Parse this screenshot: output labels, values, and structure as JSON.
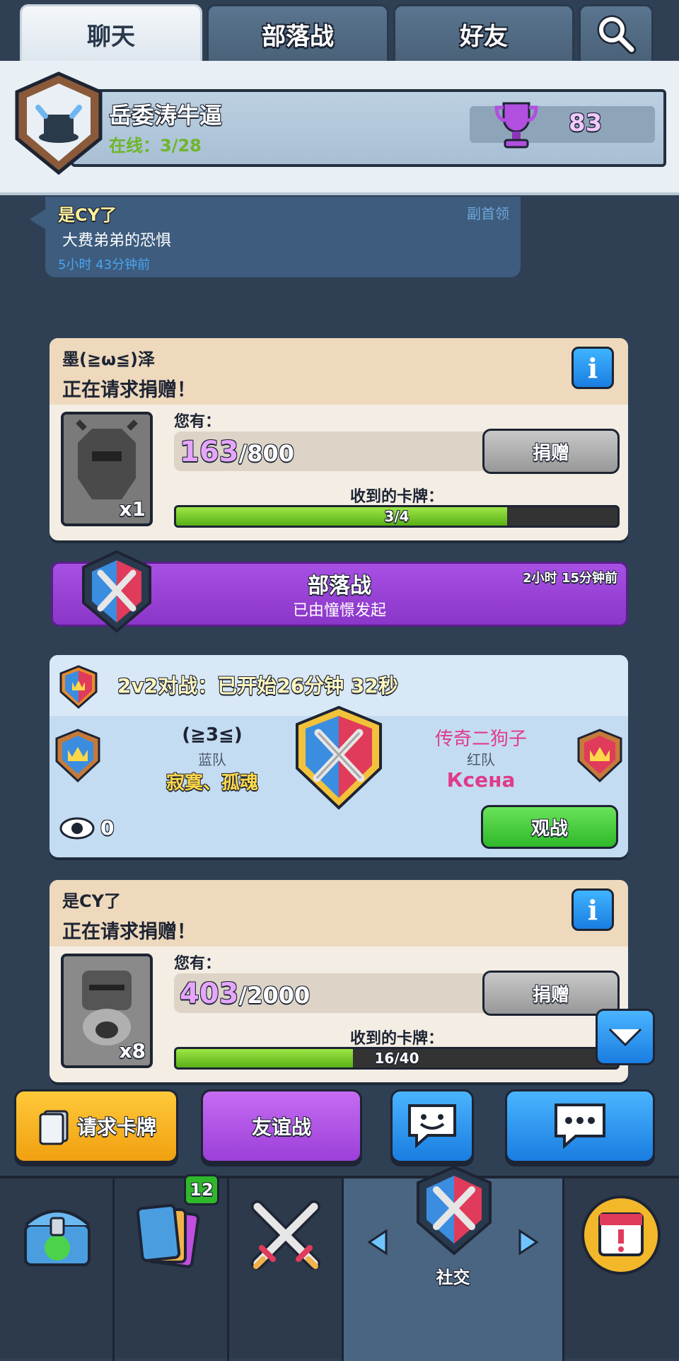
{
  "tabs": [
    {
      "label": "聊天"
    },
    {
      "label": "部落战"
    },
    {
      "label": "好友"
    }
  ],
  "clan": {
    "name": "岳委涛牛逼",
    "online_label": "在线：",
    "online_value": "3/28",
    "trophies": "83"
  },
  "message": {
    "author": "是CY了",
    "role": "副首领",
    "text": "大费弟弟的恐惧",
    "time": "5小时 43分钟前"
  },
  "request1": {
    "author": "墨(≧ω≦)泽",
    "status": "正在请求捐赠！",
    "have_label": "您有：",
    "have_current": "163",
    "have_total": "/800",
    "donate_label": "捐赠",
    "received_label": "收到的卡牌：",
    "progress_text": "3/4",
    "progress": 0.75,
    "card_count": "x1"
  },
  "war": {
    "title": "部落战",
    "subtitle": "已由憧憬发起",
    "time": "2小时 15分钟前"
  },
  "battle": {
    "title": "2v2对战：已开始26分钟 32秒",
    "blue_clan": "(≧3≦)",
    "blue_team": "蓝队",
    "blue_players": "寂寞、孤魂",
    "red_clan": "传奇二狗子",
    "red_team": "红队",
    "red_player": "Ксена",
    "spectators": "0",
    "watch_label": "观战"
  },
  "request2": {
    "author": "是CY了",
    "status": "正在请求捐赠！",
    "have_label": "您有：",
    "have_current": "403",
    "have_total": "/2000",
    "donate_label": "捐赠",
    "received_label": "收到的卡牌：",
    "progress_text": "16/40",
    "progress": 0.4,
    "card_count": "x8"
  },
  "actions": {
    "request_cards": "请求卡牌",
    "friendly_battle": "友谊战"
  },
  "nav": {
    "cards_badge": "12",
    "social_label": "社交"
  },
  "colors": {
    "purple": "#9b3fd8",
    "green": "#3fcf3a",
    "blue": "#2a9bf0",
    "gold": "#f6b820"
  }
}
